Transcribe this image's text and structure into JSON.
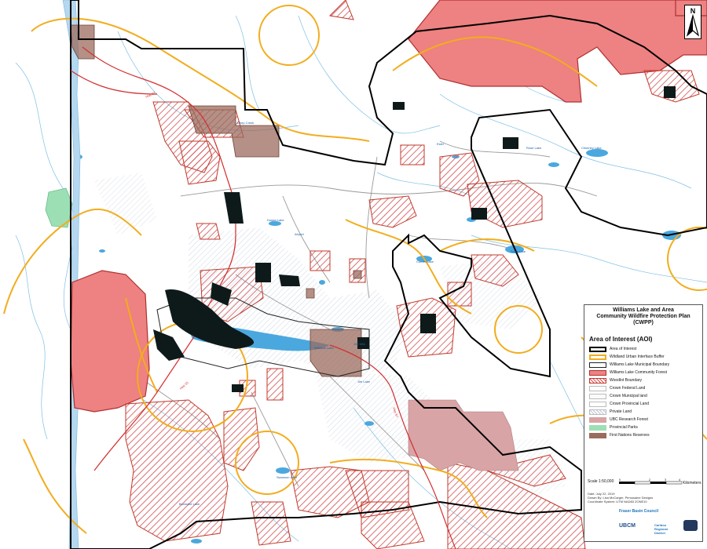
{
  "legend": {
    "title_line1": "Williams Lake and Area",
    "title_line2": "Community Wildfire Protection Plan (CWPP)",
    "heading": "Area of Interest (AOI)",
    "items": [
      {
        "label": "Area of Interest",
        "style": "black-outline"
      },
      {
        "label": "Wildland Urban Interface Buffer",
        "style": "orange-outline"
      },
      {
        "label": "Williams Lake Municipal Boundary",
        "style": "black-outline"
      },
      {
        "label": "Williams Lake Community Forest",
        "style": "red-outline"
      },
      {
        "label": "Woodlot Boundary",
        "style": "red-hatch"
      },
      {
        "label": "Crown Federal Land",
        "style": "plain"
      },
      {
        "label": "Crown Municipal land",
        "style": "plain"
      },
      {
        "label": "Crown Provincial Land",
        "style": "plain"
      },
      {
        "label": "Private Land",
        "style": "light-hatch"
      },
      {
        "label": "UBC Research Forest",
        "style": "pink-fill"
      },
      {
        "label": "Provincial Parks",
        "style": "green-fill"
      },
      {
        "label": "First Nations Reserves",
        "style": "brown-fill"
      }
    ],
    "scale_label": "Scale 1:50,000",
    "scale_ticks": [
      "0",
      "2",
      "3",
      "4"
    ],
    "scale_unit": "Kilometers",
    "credits": [
      "Date: July 22, 2019",
      "Drawn By: Lisa McCarger, Pirmusaine Designs",
      "Coordinate System: UTM NAD83 ZONE10"
    ],
    "logos": [
      "UBCM",
      "Fraser Basin Council",
      "Cariboo Regional District"
    ]
  },
  "place_labels": [
    "Williams Lake",
    "Hwy 97",
    "Hwy 20",
    "Hwy 97",
    "Rose Lake",
    "Soda Lake",
    "Comer Lake",
    "Dugan Lake",
    "Jim Lake",
    "Swanson Lake",
    "Buckshot Lake",
    "Chimney Lake",
    "Esler",
    "Airport",
    "Deep Creek",
    "150 Mile"
  ],
  "colors": {
    "water": "#4aa8de",
    "woodlot": "#c0392b",
    "woodlot_hatch": "#d24e50",
    "community_forest": "#ee8181",
    "first_nations": "#9b6b5d",
    "wui_buffer": "#f2ad1d",
    "roads": "#9a9a9a",
    "highway": "#d32f2f",
    "park": "#9ddfb5",
    "ubc_forest": "#d8a4a6"
  },
  "north_arrow": "N"
}
